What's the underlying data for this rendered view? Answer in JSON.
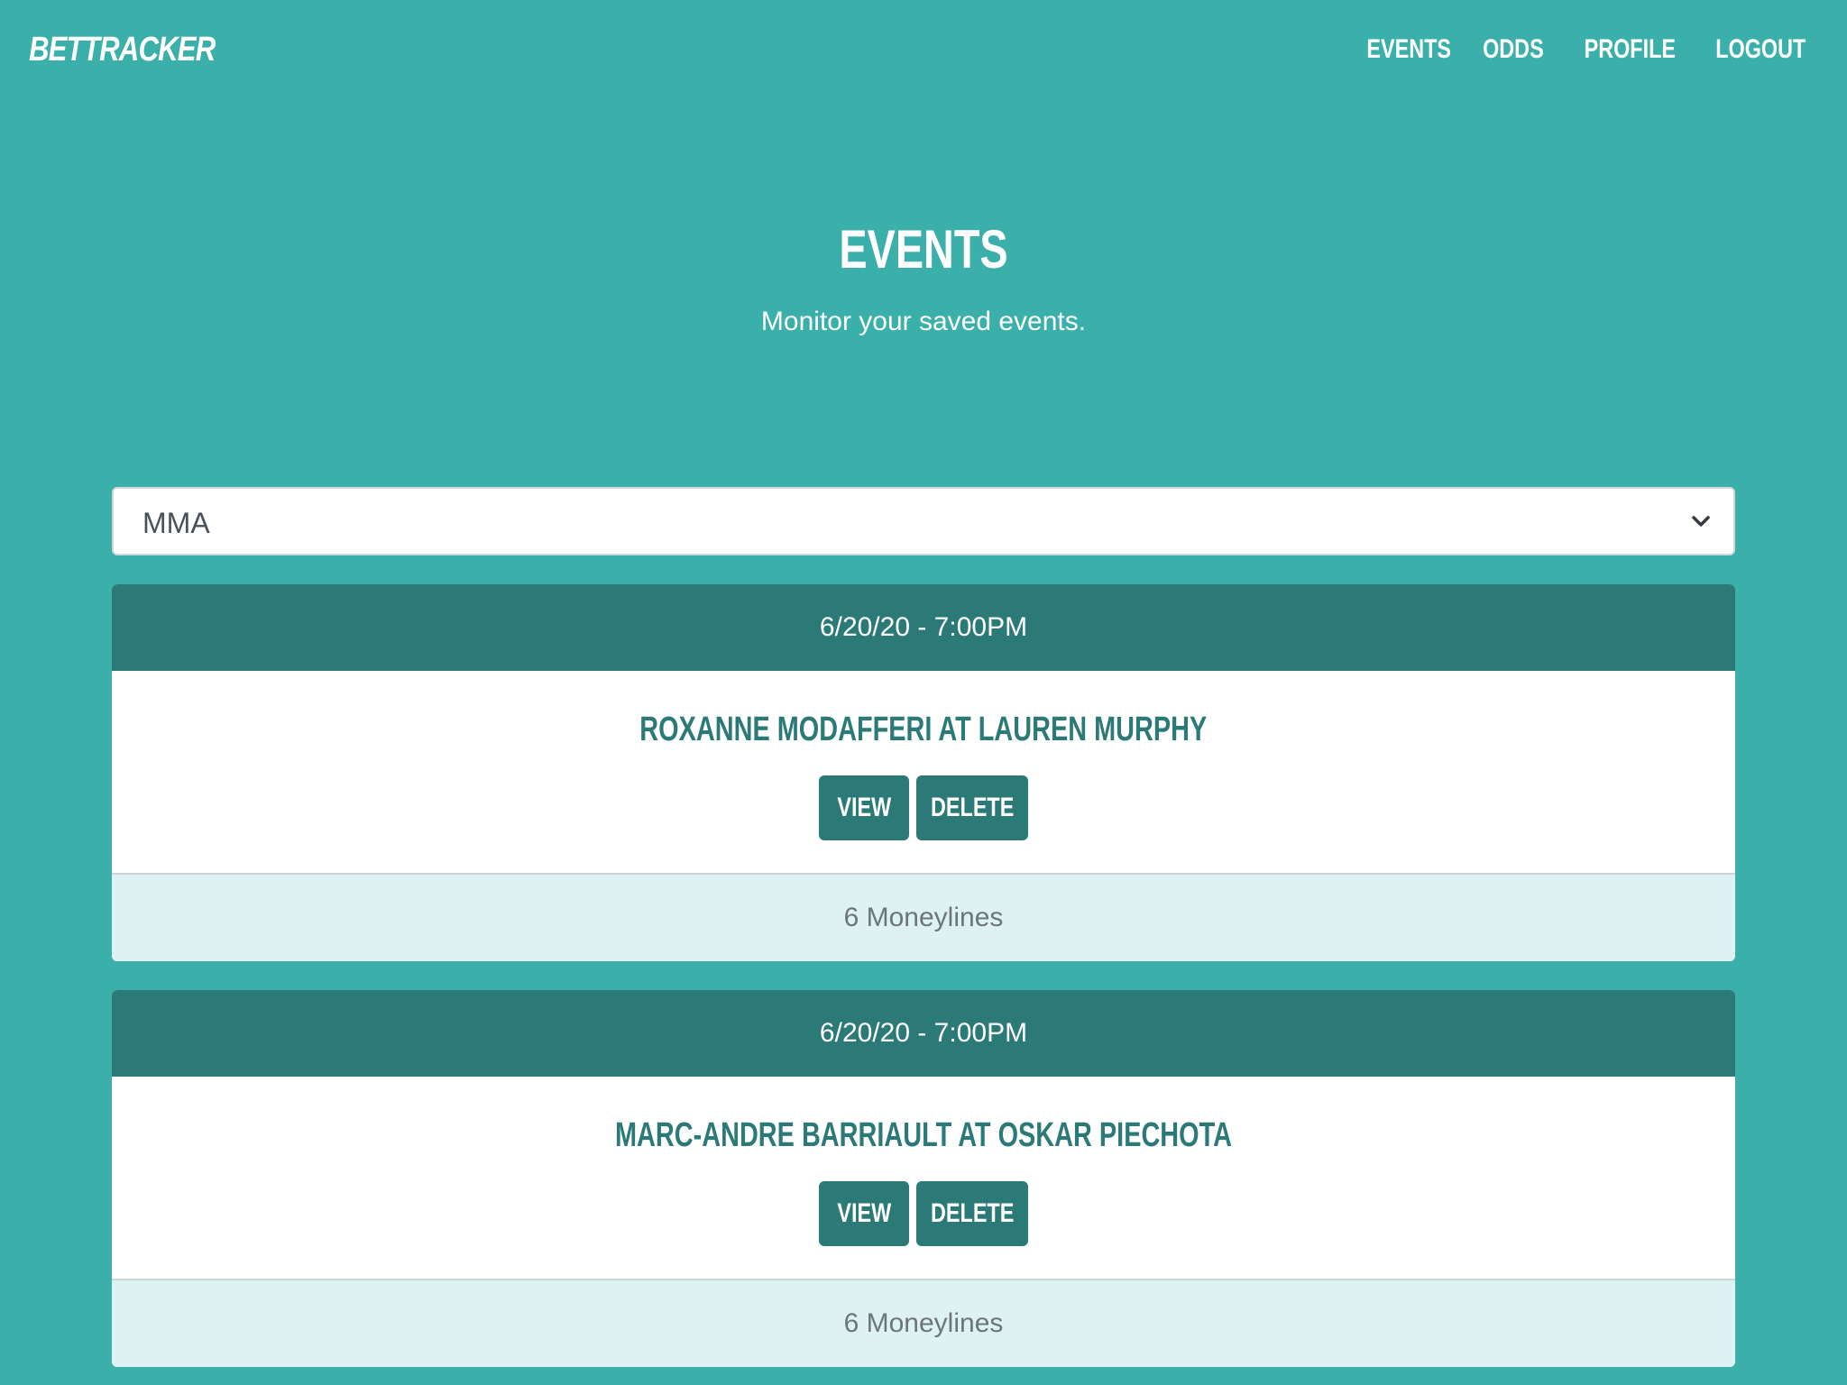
{
  "nav": {
    "brand": "BETTRACKER",
    "links": [
      "EVENTS",
      "ODDS",
      "PROFILE",
      "LOGOUT"
    ]
  },
  "hero": {
    "title": "EVENTS",
    "subtitle": "Monitor your saved events."
  },
  "filter": {
    "selected": "MMA"
  },
  "events": [
    {
      "datetime": "6/20/20 - 7:00PM",
      "matchup": "ROXANNE MODAFFERI AT LAUREN MURPHY",
      "view_label": "VIEW",
      "delete_label": "DELETE",
      "footer": "6 Moneylines"
    },
    {
      "datetime": "6/20/20 - 7:00PM",
      "matchup": "MARC-ANDRE BARRIAULT AT OSKAR PIECHOTA",
      "view_label": "VIEW",
      "delete_label": "DELETE",
      "footer": "6 Moneylines"
    }
  ],
  "colors": {
    "background": "#3bafa9",
    "primary_dark": "#2b7a78",
    "footer_bg": "#def2f1",
    "white": "#ffffff"
  },
  "icons": {
    "select_chevron": "chevron-down-icon"
  }
}
